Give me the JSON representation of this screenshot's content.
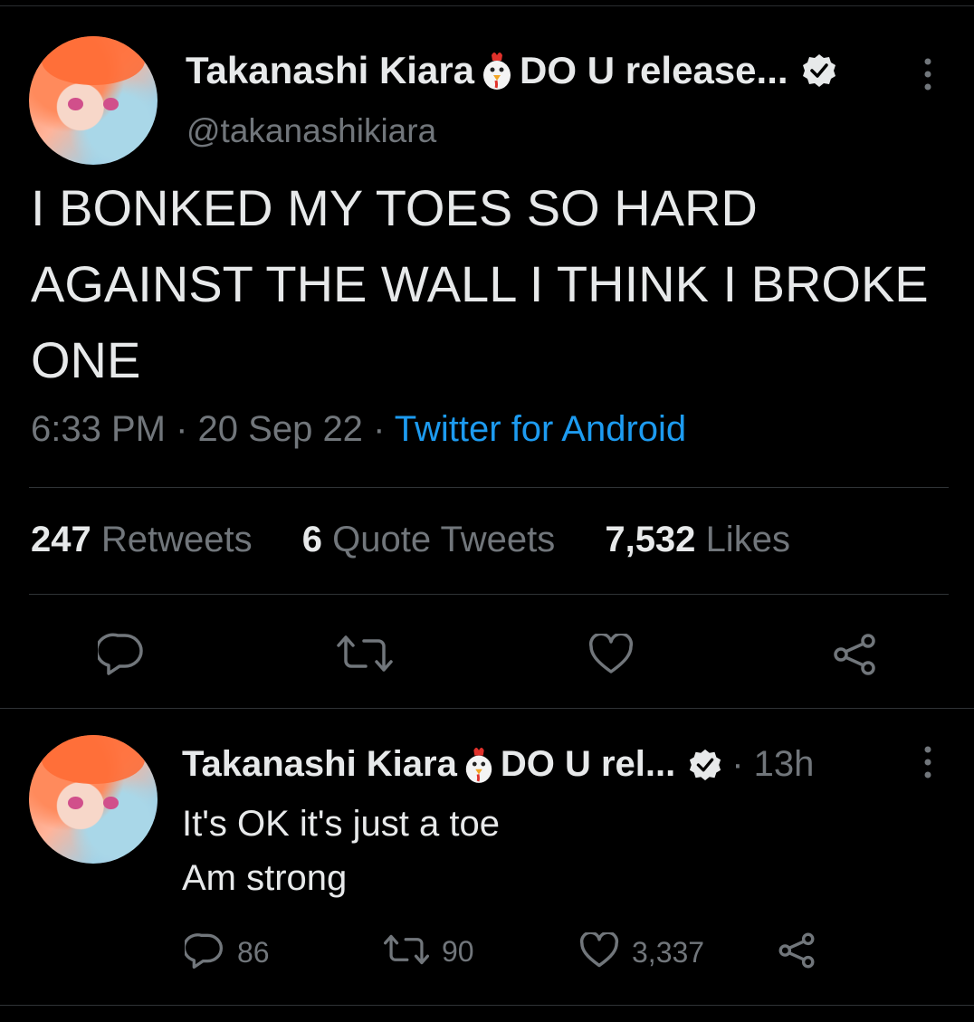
{
  "tweet": {
    "author_name": "Takanashi Kiara",
    "author_suffix": "DO U release...",
    "handle": "@takanashikiara",
    "text": "I BONKED MY TOES SO HARD AGAINST THE WALL I THINK I BROKE ONE",
    "time": "6:33 PM",
    "date": "20 Sep 22",
    "source": "Twitter for Android",
    "separator": "·",
    "stats": {
      "retweets_count": "247",
      "retweets_label": "Retweets",
      "quotes_count": "6",
      "quotes_label": "Quote Tweets",
      "likes_count": "7,532",
      "likes_label": "Likes"
    }
  },
  "reply": {
    "author_name": "Takanashi Kiara",
    "author_suffix": "DO U rel...",
    "time": "· 13h",
    "line1": "It's OK it's just a toe",
    "line2": "Am strong",
    "reply_count": "86",
    "retweet_count": "90",
    "like_count": "3,337"
  },
  "colors": {
    "background": "#000000",
    "text": "#e7e9ea",
    "secondary": "#71767b",
    "link": "#1d9bf0",
    "divider": "#2f3336"
  },
  "icons": [
    "chicken-emoji-icon",
    "verified-badge-icon",
    "more-icon",
    "reply-icon",
    "retweet-icon",
    "like-icon",
    "share-icon"
  ]
}
